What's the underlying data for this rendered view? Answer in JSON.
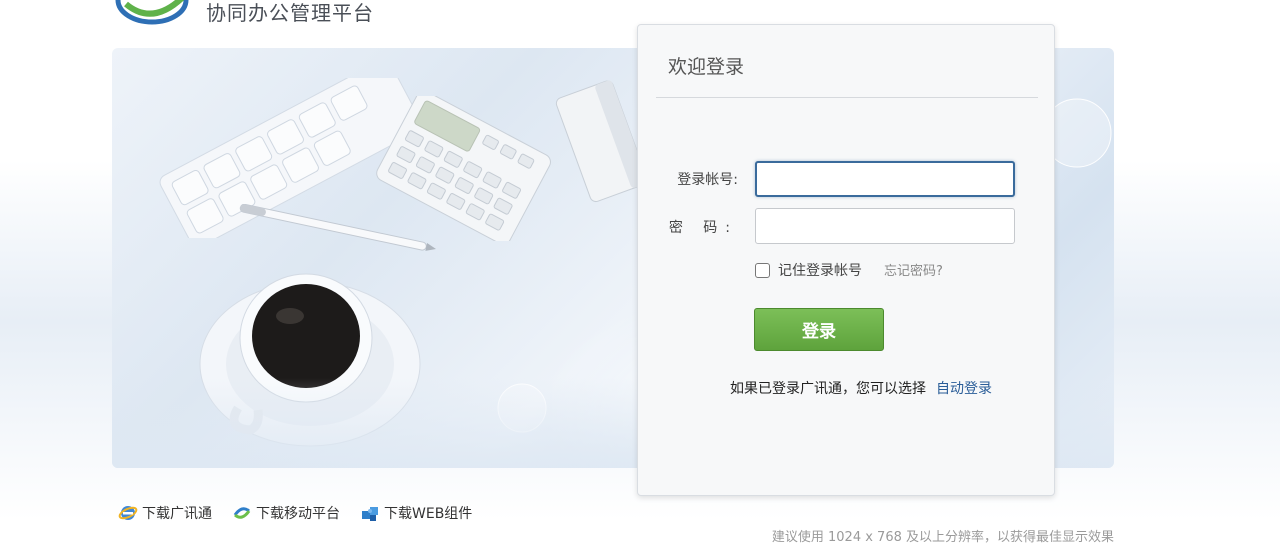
{
  "header": {
    "title": "协同办公管理平台"
  },
  "login": {
    "title": "欢迎登录",
    "account_label": "登录帐号:",
    "account_value": "",
    "password_label": "密 码:",
    "password_value": "",
    "remember_label": "记住登录帐号",
    "remember_checked": false,
    "forgot_label": "忘记密码?",
    "submit_label": "登录",
    "auto_text": "如果已登录广讯通，您可以选择",
    "auto_link": "自动登录"
  },
  "footer": {
    "downloads": [
      {
        "label": "下载广讯通",
        "icon": "ie-globe-icon"
      },
      {
        "label": "下载移动平台",
        "icon": "mobile-platform-icon"
      },
      {
        "label": "下载WEB组件",
        "icon": "puzzle-component-icon"
      }
    ],
    "resolution_note": "建议使用 1024 x 768 及以上分辨率，以获得最佳显示效果"
  },
  "colors": {
    "accent": "#3a6b9c",
    "login_button": "#6aaf47",
    "link": "#2a5d98"
  }
}
